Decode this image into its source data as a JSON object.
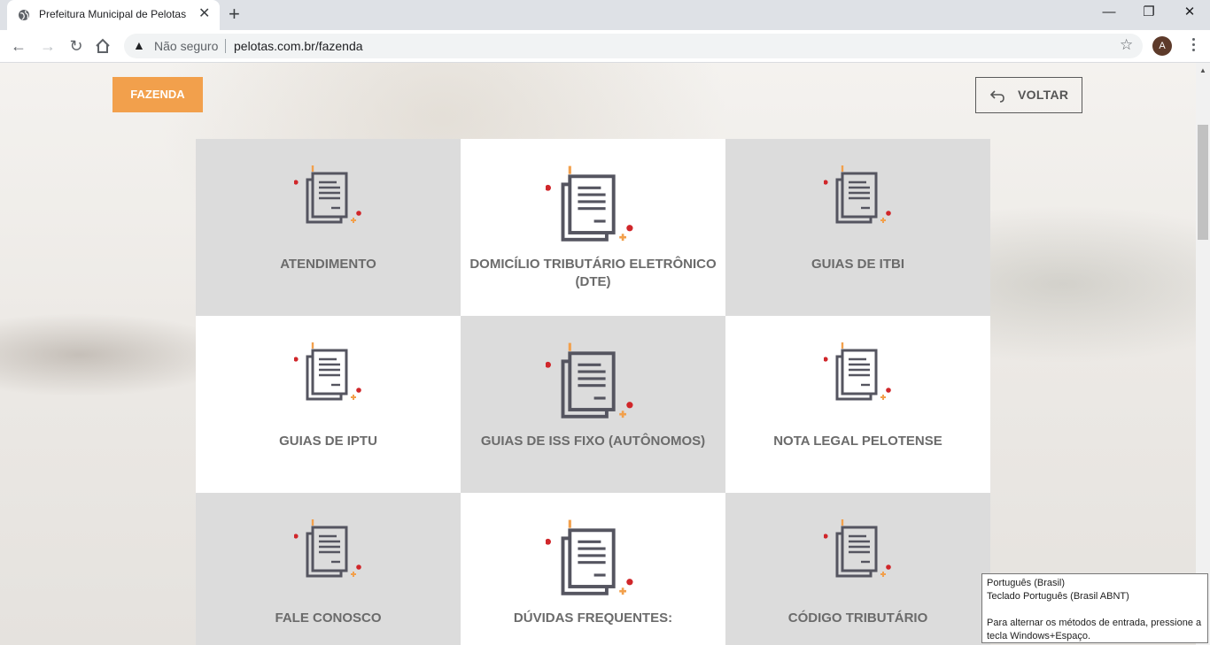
{
  "browser": {
    "tab_title": "Prefeitura Municipal de Pelotas",
    "tab_close": "✕",
    "new_tab": "+",
    "window_controls": [
      "—",
      "❐",
      "✕"
    ],
    "security_label": "Não seguro",
    "url": "pelotas.com.br/fazenda",
    "profile_initial": "A"
  },
  "page": {
    "section_button": "FAZENDA",
    "back_button": "VOLTAR",
    "tiles": [
      {
        "label": "ATENDIMENTO",
        "icon": "document-icon"
      },
      {
        "label": "DOMICÍLIO TRIBUTÁRIO ELETRÔNICO (DTE)",
        "icon": "document-icon"
      },
      {
        "label": "GUIAS DE ITBI",
        "icon": "document-icon"
      },
      {
        "label": "GUIAS DE IPTU",
        "icon": "document-icon"
      },
      {
        "label": "GUIAS DE ISS FIXO (AUTÔNOMOS)",
        "icon": "document-icon"
      },
      {
        "label": "NOTA LEGAL PELOTENSE",
        "icon": "document-icon"
      },
      {
        "label": "FALE CONOSCO",
        "icon": "document-icon"
      },
      {
        "label": "DÚVIDAS FREQUENTES:",
        "icon": "document-icon"
      },
      {
        "label": "CÓDIGO TRIBUTÁRIO",
        "icon": "document-icon"
      }
    ]
  },
  "ime_tooltip": {
    "line1": "Português (Brasil)",
    "line2": "Teclado Português (Brasil ABNT)",
    "line3": "Para alternar os métodos de entrada, pressione a tecla Windows+Espaço."
  },
  "colors": {
    "accent_orange": "#f2a04c",
    "tile_gray": "#dcdcdc",
    "icon_dark": "#555560",
    "icon_red": "#d0262a",
    "icon_orange": "#f2a04c"
  }
}
